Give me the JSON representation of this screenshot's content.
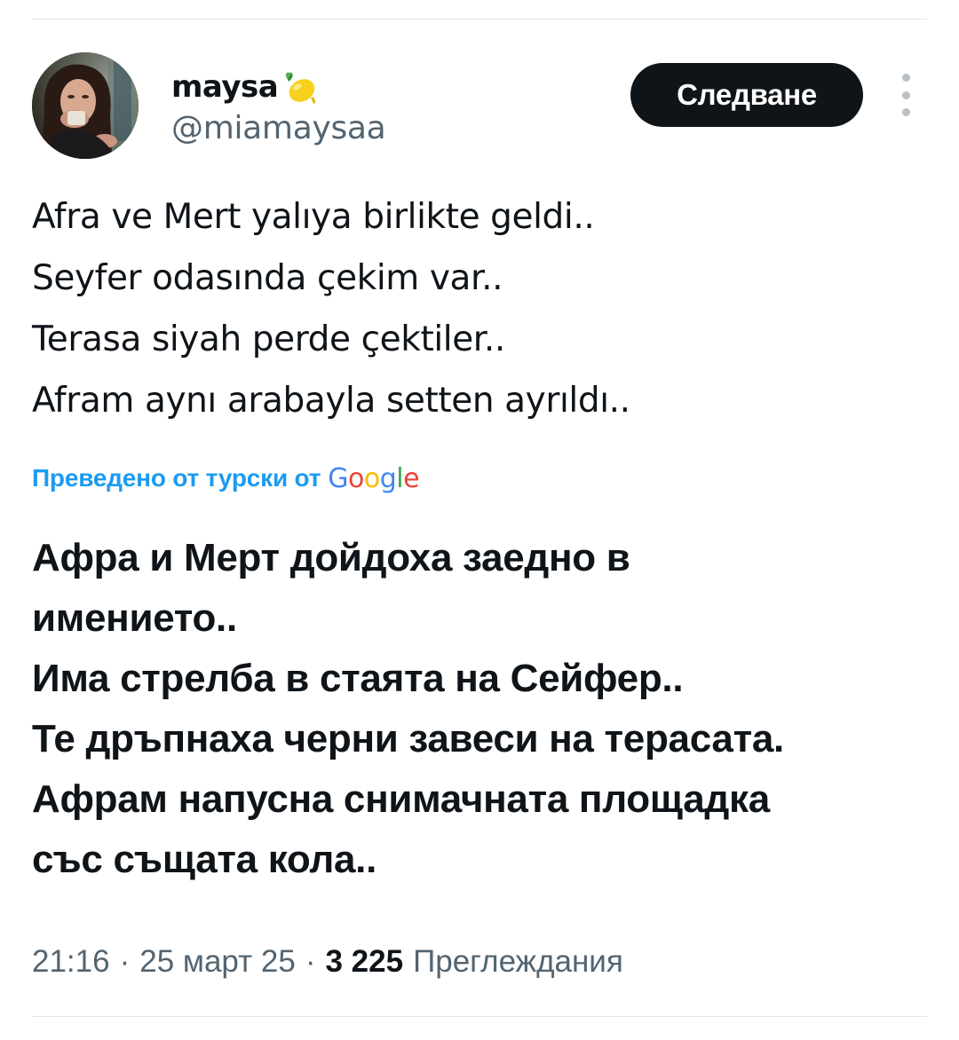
{
  "author": {
    "display_name": "maysa",
    "emoji": "lemon-icon",
    "handle": "@miamaysaa",
    "avatar": "avatar-photo"
  },
  "actions": {
    "follow_label": "Следване",
    "more_icon": "more-vertical-icon"
  },
  "tweet": {
    "original_lines": [
      "Afra ve Mert yalıya birlikte geldi..",
      "Seyfer odasında çekim var..",
      "Terasa siyah perde çektiler..",
      "Afram aynı arabayla setten ayrıldı.."
    ],
    "translated_by": "Преведено от турски от",
    "translator_logo": "Google",
    "translation_lines": [
      "Афра и Мерт дойдоха заедно в",
      "имението..",
      "Има стрелба в стаята на Сейфер..",
      "Те дръпнаха черни завеси на терасата.",
      "Афрам напусна снимачната площадка",
      "със същата кола.."
    ]
  },
  "meta": {
    "time": "21:16",
    "separator": "·",
    "date": "25 март 25",
    "views_count": "3 225",
    "views_label": "Преглеждания"
  },
  "colors": {
    "text": "#0f1419",
    "secondary": "#536471",
    "link": "#1d9bf0",
    "button_bg": "#0f1419",
    "google_blue": "#4285f4",
    "google_red": "#ea4335",
    "google_yellow": "#fbbc05",
    "google_green": "#34a853"
  }
}
